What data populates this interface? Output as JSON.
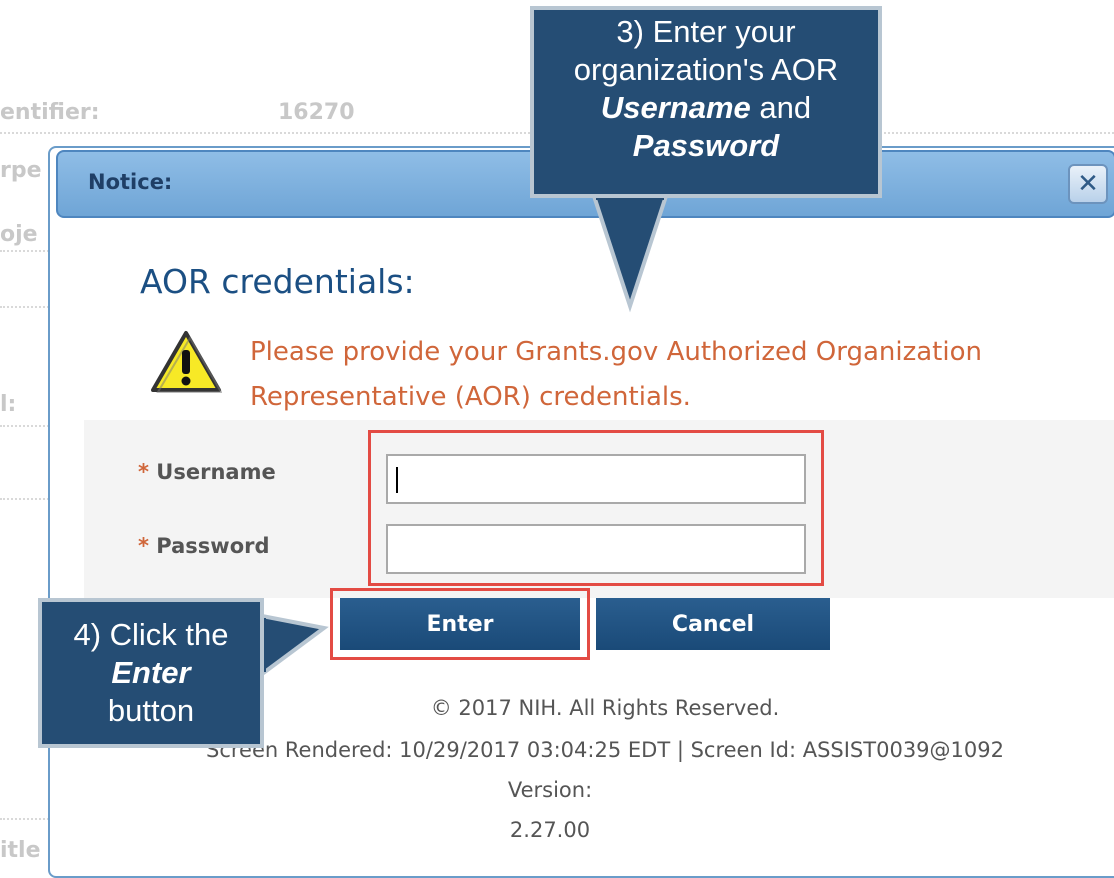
{
  "background": {
    "fragment_top": "entifier:",
    "fragment_number": "16270",
    "fragment_2": "rpe",
    "fragment_3": "oje",
    "fragment_4": "l:",
    "fragment_bottom": "itle"
  },
  "dialog": {
    "title": "Notice:",
    "close_icon": "close-icon",
    "heading": "AOR credentials:",
    "warning_icon": "warning-icon",
    "warning_text": "Please provide your Grants.gov Authorized Organization Representative (AOR) credentials.",
    "username_label": "Username",
    "password_label": "Password",
    "required_mark": "*",
    "username_value": "",
    "password_value": "",
    "enter_button": "Enter",
    "cancel_button": "Cancel",
    "copyright": "© 2017 NIH. All Rights Reserved.",
    "screen_info": "Screen Rendered: 10/29/2017 03:04:25 EDT | Screen Id: ASSIST0039@1092",
    "version_label": "Version:",
    "version_value": "2.27.00"
  },
  "callouts": {
    "step3_line1": "3) Enter your",
    "step3_line2": "organization's AOR",
    "step3_username": "Username",
    "step3_and": "and",
    "step3_password": "Password",
    "step4_line1": "4) Click the",
    "step4_enter": "Enter",
    "step4_button": "button"
  },
  "colors": {
    "accent": "#1b4f83",
    "warning": "#d0663a",
    "callout_bg": "#254d74",
    "highlight": "#e34b44"
  }
}
